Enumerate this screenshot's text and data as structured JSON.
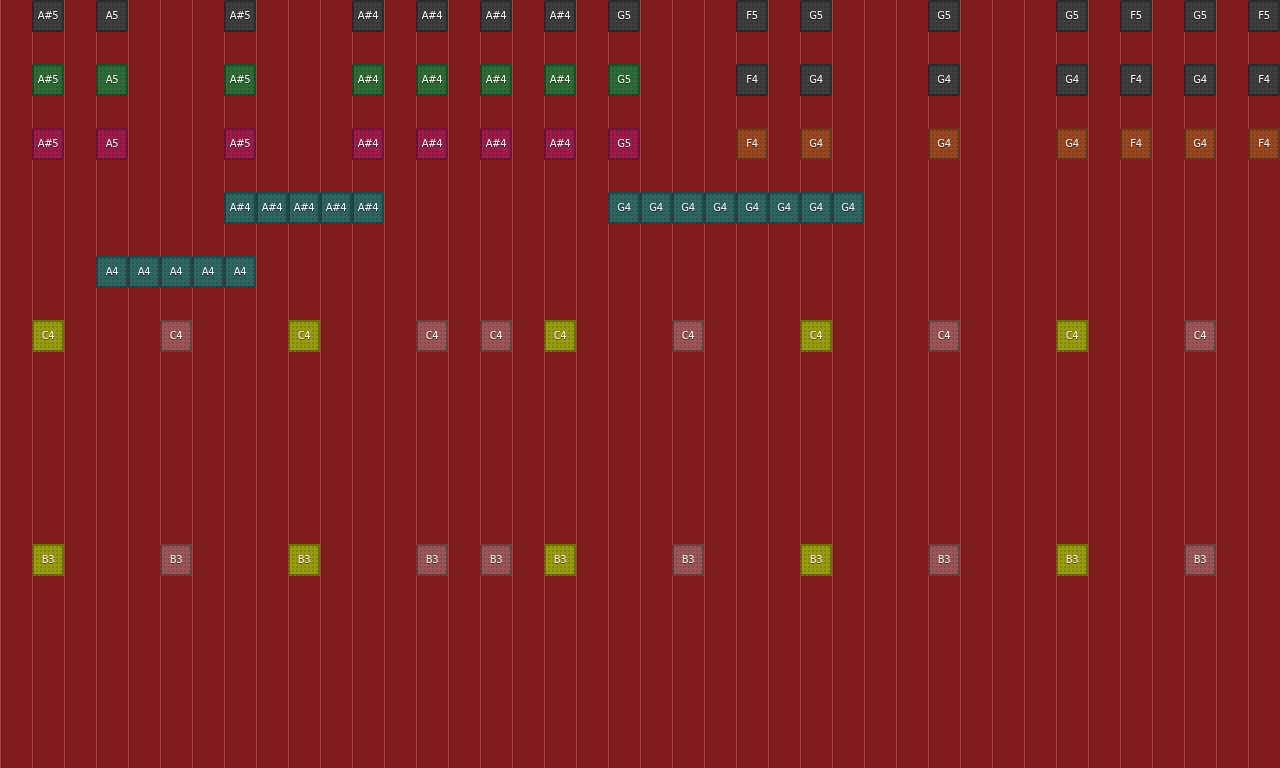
{
  "lanes": [
    {
      "kind": "notes",
      "cells": [
        {
          "kind": "rest"
        },
        {
          "kind": "note",
          "label": "A#5",
          "color": "#3d3d3d"
        },
        {
          "kind": "rest"
        },
        {
          "kind": "note",
          "label": "A5",
          "color": "#3d3d3d"
        },
        {
          "kind": "rest"
        },
        {
          "kind": "rest"
        },
        {
          "kind": "rest"
        },
        {
          "kind": "note",
          "label": "A#5",
          "color": "#3d3d3d"
        },
        {
          "kind": "rest"
        },
        {
          "kind": "rest"
        },
        {
          "kind": "rest"
        },
        {
          "kind": "note",
          "label": "A#4",
          "color": "#3d3d3d"
        },
        {
          "kind": "rest"
        },
        {
          "kind": "note",
          "label": "A#4",
          "color": "#3d3d3d"
        },
        {
          "kind": "rest"
        },
        {
          "kind": "note",
          "label": "A#4",
          "color": "#3d3d3d"
        },
        {
          "kind": "rest"
        },
        {
          "kind": "note",
          "label": "A#4",
          "color": "#3d3d3d"
        },
        {
          "kind": "rest"
        },
        {
          "kind": "note",
          "label": "G5",
          "color": "#3d3d3d"
        },
        {
          "kind": "rest"
        },
        {
          "kind": "rest"
        },
        {
          "kind": "rest"
        },
        {
          "kind": "note",
          "label": "F5",
          "color": "#3d3d3d"
        },
        {
          "kind": "rest"
        },
        {
          "kind": "note",
          "label": "G5",
          "color": "#3d3d3d"
        },
        {
          "kind": "rest"
        },
        {
          "kind": "rest"
        },
        {
          "kind": "rest"
        },
        {
          "kind": "note",
          "label": "G5",
          "color": "#3d3d3d"
        },
        {
          "kind": "rest"
        },
        {
          "kind": "rest"
        },
        {
          "kind": "rest"
        },
        {
          "kind": "note",
          "label": "G5",
          "color": "#3d3d3d"
        },
        {
          "kind": "rest"
        },
        {
          "kind": "note",
          "label": "F5",
          "color": "#3d3d3d"
        },
        {
          "kind": "rest"
        },
        {
          "kind": "note",
          "label": "G5",
          "color": "#3d3d3d"
        },
        {
          "kind": "rest"
        },
        {
          "kind": "note",
          "label": "F5",
          "color": "#3d3d3d"
        }
      ]
    },
    {
      "kind": "spacer"
    },
    {
      "kind": "notes",
      "cells": [
        {
          "kind": "rest"
        },
        {
          "kind": "note",
          "label": "A#5",
          "color": "#2d6a35"
        },
        {
          "kind": "rest"
        },
        {
          "kind": "note",
          "label": "A5",
          "color": "#2d6a35"
        },
        {
          "kind": "rest"
        },
        {
          "kind": "rest"
        },
        {
          "kind": "rest"
        },
        {
          "kind": "note",
          "label": "A#5",
          "color": "#2d6a35"
        },
        {
          "kind": "rest"
        },
        {
          "kind": "rest"
        },
        {
          "kind": "rest"
        },
        {
          "kind": "note",
          "label": "A#4",
          "color": "#2d6a35"
        },
        {
          "kind": "rest"
        },
        {
          "kind": "note",
          "label": "A#4",
          "color": "#2d6a35"
        },
        {
          "kind": "rest"
        },
        {
          "kind": "note",
          "label": "A#4",
          "color": "#2d6a35"
        },
        {
          "kind": "rest"
        },
        {
          "kind": "note",
          "label": "A#4",
          "color": "#2d6a35"
        },
        {
          "kind": "rest"
        },
        {
          "kind": "note",
          "label": "G5",
          "color": "#2d6a35"
        },
        {
          "kind": "rest"
        },
        {
          "kind": "rest"
        },
        {
          "kind": "rest"
        },
        {
          "kind": "note",
          "label": "F4",
          "color": "#3d3d3d"
        },
        {
          "kind": "rest"
        },
        {
          "kind": "note",
          "label": "G4",
          "color": "#3d3d3d"
        },
        {
          "kind": "rest"
        },
        {
          "kind": "rest"
        },
        {
          "kind": "rest"
        },
        {
          "kind": "note",
          "label": "G4",
          "color": "#3d3d3d"
        },
        {
          "kind": "rest"
        },
        {
          "kind": "rest"
        },
        {
          "kind": "rest"
        },
        {
          "kind": "note",
          "label": "G4",
          "color": "#3d3d3d"
        },
        {
          "kind": "rest"
        },
        {
          "kind": "note",
          "label": "F4",
          "color": "#3d3d3d"
        },
        {
          "kind": "rest"
        },
        {
          "kind": "note",
          "label": "G4",
          "color": "#3d3d3d"
        },
        {
          "kind": "rest"
        },
        {
          "kind": "note",
          "label": "F4",
          "color": "#3d3d3d"
        }
      ]
    },
    {
      "kind": "spacer"
    },
    {
      "kind": "notes",
      "cells": [
        {
          "kind": "rest"
        },
        {
          "kind": "note",
          "label": "A#5",
          "color": "#9b1b4b"
        },
        {
          "kind": "rest"
        },
        {
          "kind": "note",
          "label": "A5",
          "color": "#9b1b4b"
        },
        {
          "kind": "rest"
        },
        {
          "kind": "rest"
        },
        {
          "kind": "rest"
        },
        {
          "kind": "note",
          "label": "A#5",
          "color": "#9b1b4b"
        },
        {
          "kind": "rest"
        },
        {
          "kind": "rest"
        },
        {
          "kind": "rest"
        },
        {
          "kind": "note",
          "label": "A#4",
          "color": "#9b1b4b"
        },
        {
          "kind": "rest"
        },
        {
          "kind": "note",
          "label": "A#4",
          "color": "#9b1b4b"
        },
        {
          "kind": "rest"
        },
        {
          "kind": "note",
          "label": "A#4",
          "color": "#9b1b4b"
        },
        {
          "kind": "rest"
        },
        {
          "kind": "note",
          "label": "A#4",
          "color": "#9b1b4b"
        },
        {
          "kind": "rest"
        },
        {
          "kind": "note",
          "label": "G5",
          "color": "#9b1b4b"
        },
        {
          "kind": "rest"
        },
        {
          "kind": "rest"
        },
        {
          "kind": "rest"
        },
        {
          "kind": "note",
          "label": "F4",
          "color": "#97471f"
        },
        {
          "kind": "rest"
        },
        {
          "kind": "note",
          "label": "G4",
          "color": "#97471f"
        },
        {
          "kind": "rest"
        },
        {
          "kind": "rest"
        },
        {
          "kind": "rest"
        },
        {
          "kind": "note",
          "label": "G4",
          "color": "#97471f"
        },
        {
          "kind": "rest"
        },
        {
          "kind": "rest"
        },
        {
          "kind": "rest"
        },
        {
          "kind": "note",
          "label": "G4",
          "color": "#97471f"
        },
        {
          "kind": "rest"
        },
        {
          "kind": "note",
          "label": "F4",
          "color": "#97471f"
        },
        {
          "kind": "rest"
        },
        {
          "kind": "note",
          "label": "G4",
          "color": "#97471f"
        },
        {
          "kind": "rest"
        },
        {
          "kind": "note",
          "label": "F4",
          "color": "#97471f"
        }
      ]
    },
    {
      "kind": "spacer"
    },
    {
      "kind": "notes",
      "cells": [
        {
          "kind": "rest"
        },
        {
          "kind": "rest"
        },
        {
          "kind": "rest"
        },
        {
          "kind": "rest"
        },
        {
          "kind": "rest"
        },
        {
          "kind": "rest"
        },
        {
          "kind": "rest"
        },
        {
          "kind": "note",
          "label": "A#4",
          "color": "#2e6462"
        },
        {
          "kind": "note",
          "label": "A#4",
          "color": "#2e6462"
        },
        {
          "kind": "note",
          "label": "A#4",
          "color": "#2e6462"
        },
        {
          "kind": "note",
          "label": "A#4",
          "color": "#2e6462"
        },
        {
          "kind": "note",
          "label": "A#4",
          "color": "#2e6462"
        },
        {
          "kind": "rest"
        },
        {
          "kind": "rest"
        },
        {
          "kind": "rest"
        },
        {
          "kind": "rest"
        },
        {
          "kind": "rest"
        },
        {
          "kind": "rest"
        },
        {
          "kind": "rest"
        },
        {
          "kind": "note",
          "label": "G4",
          "color": "#2e6462"
        },
        {
          "kind": "note",
          "label": "G4",
          "color": "#2e6462"
        },
        {
          "kind": "note",
          "label": "G4",
          "color": "#2e6462"
        },
        {
          "kind": "note",
          "label": "G4",
          "color": "#2e6462"
        },
        {
          "kind": "note",
          "label": "G4",
          "color": "#2e6462"
        },
        {
          "kind": "note",
          "label": "G4",
          "color": "#2e6462"
        },
        {
          "kind": "note",
          "label": "G4",
          "color": "#2e6462"
        },
        {
          "kind": "note",
          "label": "G4",
          "color": "#2e6462"
        }
      ]
    },
    {
      "kind": "spacer"
    },
    {
      "kind": "notes",
      "cells": [
        {
          "kind": "rest"
        },
        {
          "kind": "rest"
        },
        {
          "kind": "rest"
        },
        {
          "kind": "note",
          "label": "A4",
          "color": "#2e6462"
        },
        {
          "kind": "note",
          "label": "A4",
          "color": "#2e6462"
        },
        {
          "kind": "note",
          "label": "A4",
          "color": "#2e6462"
        },
        {
          "kind": "note",
          "label": "A4",
          "color": "#2e6462"
        },
        {
          "kind": "note",
          "label": "A4",
          "color": "#2e6462"
        }
      ]
    },
    {
      "kind": "spacer"
    },
    {
      "kind": "notes",
      "cells": [
        {
          "kind": "rest"
        },
        {
          "kind": "note",
          "label": "C4",
          "color": "#999a12"
        },
        {
          "kind": "rest"
        },
        {
          "kind": "rest"
        },
        {
          "kind": "rest"
        },
        {
          "kind": "note",
          "label": "C4",
          "color": "#9a5656"
        },
        {
          "kind": "rest"
        },
        {
          "kind": "rest"
        },
        {
          "kind": "rest"
        },
        {
          "kind": "note",
          "label": "C4",
          "color": "#999a12"
        },
        {
          "kind": "rest"
        },
        {
          "kind": "rest"
        },
        {
          "kind": "rest"
        },
        {
          "kind": "note",
          "label": "C4",
          "color": "#9a5656"
        },
        {
          "kind": "rest"
        },
        {
          "kind": "note",
          "label": "C4",
          "color": "#9a5656"
        },
        {
          "kind": "rest"
        },
        {
          "kind": "note",
          "label": "C4",
          "color": "#999a12"
        },
        {
          "kind": "rest"
        },
        {
          "kind": "rest"
        },
        {
          "kind": "rest"
        },
        {
          "kind": "note",
          "label": "C4",
          "color": "#9a5656"
        },
        {
          "kind": "rest"
        },
        {
          "kind": "rest"
        },
        {
          "kind": "rest"
        },
        {
          "kind": "note",
          "label": "C4",
          "color": "#999a12"
        },
        {
          "kind": "rest"
        },
        {
          "kind": "rest"
        },
        {
          "kind": "rest"
        },
        {
          "kind": "note",
          "label": "C4",
          "color": "#9a5656"
        },
        {
          "kind": "rest"
        },
        {
          "kind": "rest"
        },
        {
          "kind": "rest"
        },
        {
          "kind": "note",
          "label": "C4",
          "color": "#999a12"
        },
        {
          "kind": "rest"
        },
        {
          "kind": "rest"
        },
        {
          "kind": "rest"
        },
        {
          "kind": "note",
          "label": "C4",
          "color": "#9a5656"
        }
      ]
    },
    {
      "kind": "spacer"
    },
    {
      "kind": "spacer"
    },
    {
      "kind": "spacer"
    },
    {
      "kind": "spacer"
    },
    {
      "kind": "spacer"
    },
    {
      "kind": "spacer"
    },
    {
      "kind": "notes",
      "cells": [
        {
          "kind": "rest"
        },
        {
          "kind": "note",
          "label": "B3",
          "color": "#999a12"
        },
        {
          "kind": "rest"
        },
        {
          "kind": "rest"
        },
        {
          "kind": "rest"
        },
        {
          "kind": "note",
          "label": "B3",
          "color": "#9a5656"
        },
        {
          "kind": "rest"
        },
        {
          "kind": "rest"
        },
        {
          "kind": "rest"
        },
        {
          "kind": "note",
          "label": "B3",
          "color": "#999a12"
        },
        {
          "kind": "rest"
        },
        {
          "kind": "rest"
        },
        {
          "kind": "rest"
        },
        {
          "kind": "note",
          "label": "B3",
          "color": "#9a5656"
        },
        {
          "kind": "rest"
        },
        {
          "kind": "note",
          "label": "B3",
          "color": "#9a5656"
        },
        {
          "kind": "rest"
        },
        {
          "kind": "note",
          "label": "B3",
          "color": "#999a12"
        },
        {
          "kind": "rest"
        },
        {
          "kind": "rest"
        },
        {
          "kind": "rest"
        },
        {
          "kind": "note",
          "label": "B3",
          "color": "#9a5656"
        },
        {
          "kind": "rest"
        },
        {
          "kind": "rest"
        },
        {
          "kind": "rest"
        },
        {
          "kind": "note",
          "label": "B3",
          "color": "#999a12"
        },
        {
          "kind": "rest"
        },
        {
          "kind": "rest"
        },
        {
          "kind": "rest"
        },
        {
          "kind": "note",
          "label": "B3",
          "color": "#9a5656"
        },
        {
          "kind": "rest"
        },
        {
          "kind": "rest"
        },
        {
          "kind": "rest"
        },
        {
          "kind": "note",
          "label": "B3",
          "color": "#999a12"
        },
        {
          "kind": "rest"
        },
        {
          "kind": "rest"
        },
        {
          "kind": "rest"
        },
        {
          "kind": "note",
          "label": "B3",
          "color": "#9a5656"
        }
      ]
    }
  ]
}
